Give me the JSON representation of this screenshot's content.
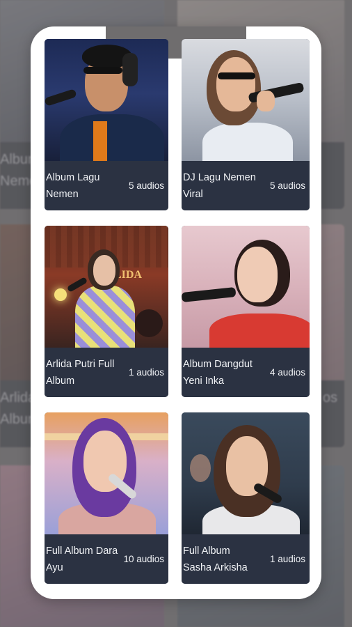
{
  "background": {
    "labels": [
      "Album",
      "Nemen",
      "Arlida",
      "Album",
      "os"
    ]
  },
  "albums": [
    {
      "title": "Album Lagu Nemen",
      "count": "5 audios"
    },
    {
      "title": "DJ Lagu Nemen Viral",
      "count": "5 audios"
    },
    {
      "title": "Arlida Putri Full Album",
      "count": "1 audios"
    },
    {
      "title": "Album Dangdut Yeni Inka",
      "count": "4 audios"
    },
    {
      "title": "Full Album Dara Ayu",
      "count": "10 audios"
    },
    {
      "title": "Full Album Sasha Arkisha",
      "count": "1 audios"
    }
  ],
  "thumbnails": {
    "card3_sign": "LIDA"
  }
}
